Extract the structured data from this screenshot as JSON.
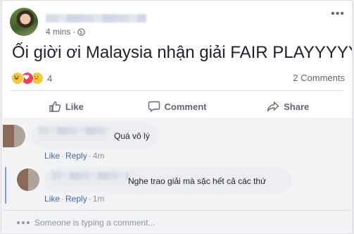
{
  "post": {
    "author_name": "",
    "timestamp": "4 mins",
    "text": "Ối giời ơi Malaysia nhận giải FAIR PLAYYYYYY",
    "reaction_icons": [
      "haha-reaction-icon",
      "love-reaction-icon",
      "sad-reaction-icon"
    ],
    "reaction_count": "4",
    "comment_count": "2 Comments"
  },
  "actions": {
    "like": "Like",
    "comment": "Comment",
    "share": "Share"
  },
  "comments": [
    {
      "author": "",
      "text": "Quá vô lý",
      "like": "Like",
      "reply": "Reply",
      "time": "4m"
    },
    {
      "author": "",
      "text": "Nghe trao giải mà sặc hết cả các thứ",
      "like": "Like",
      "reply": "Reply",
      "time": "1m"
    }
  ],
  "compose": {
    "typing_text": "Someone is typing a comment..."
  },
  "colors": {
    "link": "#4267b2",
    "muted": "#606770",
    "bubble": "#ebedf0",
    "comments_bg": "#f2f3f5"
  }
}
